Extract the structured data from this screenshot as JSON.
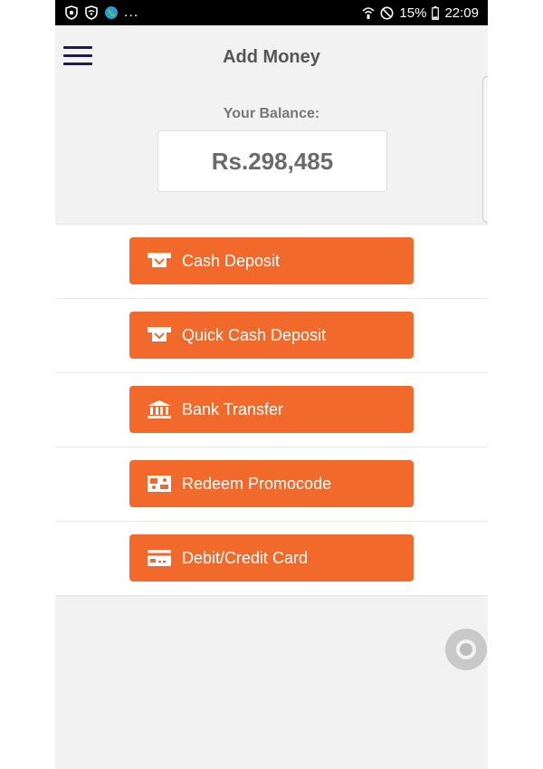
{
  "status_bar": {
    "left_icons": [
      "shield-icon",
      "wifi-shield-icon",
      "globe-icon"
    ],
    "overflow": "...",
    "right_icons": [
      "wifi-calling-icon",
      "do-not-disturb-icon"
    ],
    "battery": "15%",
    "time": "22:09"
  },
  "header": {
    "title": "Add Money",
    "menu_icon": "hamburger-menu-icon"
  },
  "balance": {
    "label": "Your Balance:",
    "amount": "Rs.298,485"
  },
  "options": [
    {
      "label": "Cash Deposit",
      "icon": "cash-deposit-icon"
    },
    {
      "label": "Quick Cash Deposit",
      "icon": "quick-cash-deposit-icon"
    },
    {
      "label": "Bank Transfer",
      "icon": "bank-icon"
    },
    {
      "label": "Redeem Promocode",
      "icon": "promocode-icon"
    },
    {
      "label": "Debit/Credit Card",
      "icon": "credit-card-icon"
    }
  ],
  "colors": {
    "accent": "#f26a2b",
    "menu": "#1f1a4d",
    "background": "#f2f2f2"
  }
}
